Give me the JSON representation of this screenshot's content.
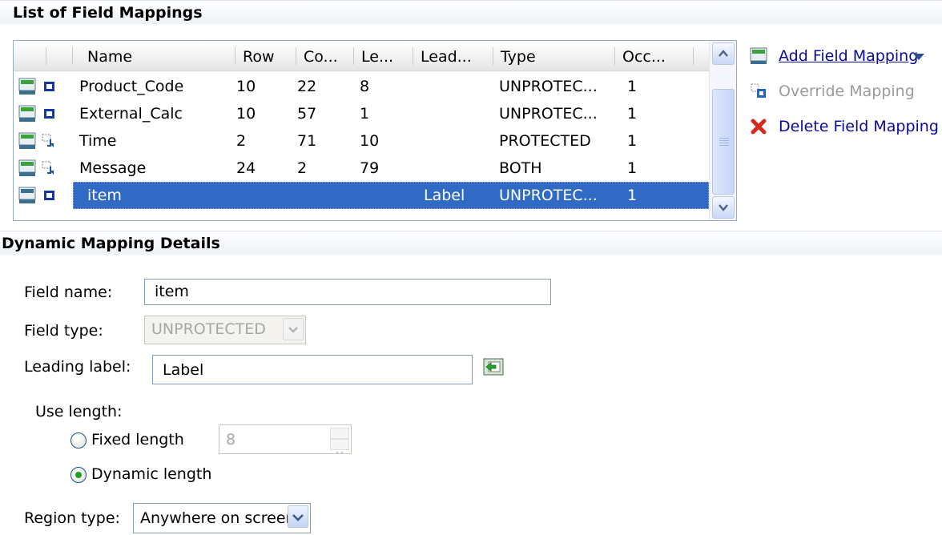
{
  "list_section": {
    "title": "List of Field Mappings",
    "columns": [
      "Name",
      "Row",
      "Co...",
      "Le...",
      "Lead...",
      "Type",
      "Occ..."
    ],
    "rows": [
      {
        "name": "Product_Code",
        "row": "10",
        "col": "22",
        "len": "8",
        "lead": "",
        "type": "UNPROTEC...",
        "occ": "1",
        "kind": "unprotected-field-icon"
      },
      {
        "name": "External_Calc",
        "row": "10",
        "col": "57",
        "len": "1",
        "lead": "",
        "type": "UNPROTEC...",
        "occ": "1",
        "kind": "unprotected-field-icon"
      },
      {
        "name": "Time",
        "row": "2",
        "col": "71",
        "len": "10",
        "lead": "",
        "type": "PROTECTED",
        "occ": "1",
        "kind": "protected-field-icon"
      },
      {
        "name": "Message",
        "row": "24",
        "col": "2",
        "len": "79",
        "lead": "",
        "type": "BOTH",
        "occ": "1",
        "kind": "protected-field-icon"
      },
      {
        "name": "item",
        "row": "",
        "col": "",
        "len": "",
        "lead": "Label",
        "type": "UNPROTEC...",
        "occ": "1",
        "kind": "unprotected-field-icon",
        "selected": true
      }
    ]
  },
  "actions": {
    "add": "Add Field Mapping",
    "override": "Override Mapping",
    "delete": "Delete Field Mapping"
  },
  "details_section": {
    "title": "Dynamic Mapping Details",
    "field_name_label": "Field name:",
    "field_name_value": "item",
    "field_type_label": "Field type:",
    "field_type_value": "UNPROTECTED",
    "leading_label_label": "Leading label:",
    "leading_label_value": "Label",
    "use_length_label": "Use length:",
    "fixed_length_label": "Fixed length",
    "fixed_length_value": "8",
    "dynamic_length_label": "Dynamic length",
    "selected_length_option": "Dynamic length",
    "region_type_label": "Region type:",
    "region_type_value": "Anywhere on screen"
  },
  "colors": {
    "selection": "#316ac5",
    "link": "#0a0a9a",
    "delete_x": "#d42a1d",
    "radio_dot": "#21a121"
  }
}
